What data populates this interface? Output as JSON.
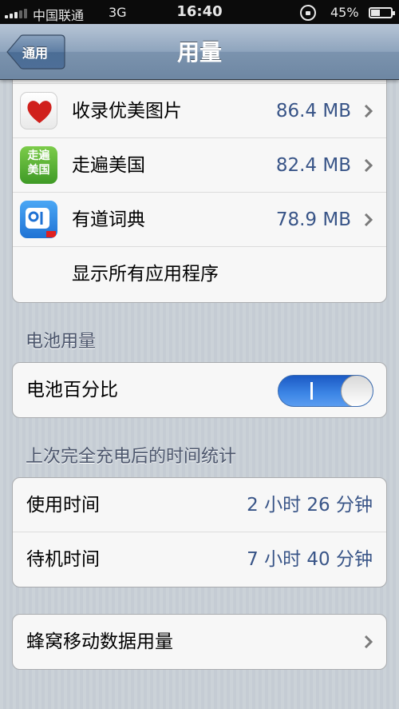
{
  "status_bar": {
    "carrier": "中国联通",
    "network": "3G",
    "time": "16:40",
    "battery_percent": "45%",
    "battery_level": 0.45
  },
  "nav": {
    "back_label": "通用",
    "title": "用量"
  },
  "storage": {
    "apps": [
      {
        "name": "收录优美图片",
        "size": "86.4 MB",
        "icon": "heart-app-icon",
        "color": "#d0201c"
      },
      {
        "name": "走遍美国",
        "size": "82.4 MB",
        "icon": "zoubian-meiguo-app-icon",
        "icon_text_top": "走遍",
        "icon_text_bottom": "美国",
        "color": "#4da02e"
      },
      {
        "name": "有道词典",
        "size": "78.9 MB",
        "icon": "youdao-dict-app-icon",
        "color": "#2f8de4"
      }
    ],
    "show_all_label": "显示所有应用程序"
  },
  "battery_usage": {
    "header": "电池用量",
    "percentage_label": "电池百分比",
    "percentage_toggle_on": true
  },
  "since_charge": {
    "header": "上次完全充电后的时间统计",
    "usage_label": "使用时间",
    "usage_value": "2 小时 26 分钟",
    "standby_label": "待机时间",
    "standby_value": "7 小时 40 分钟"
  },
  "cellular": {
    "label": "蜂窝移动数据用量"
  }
}
